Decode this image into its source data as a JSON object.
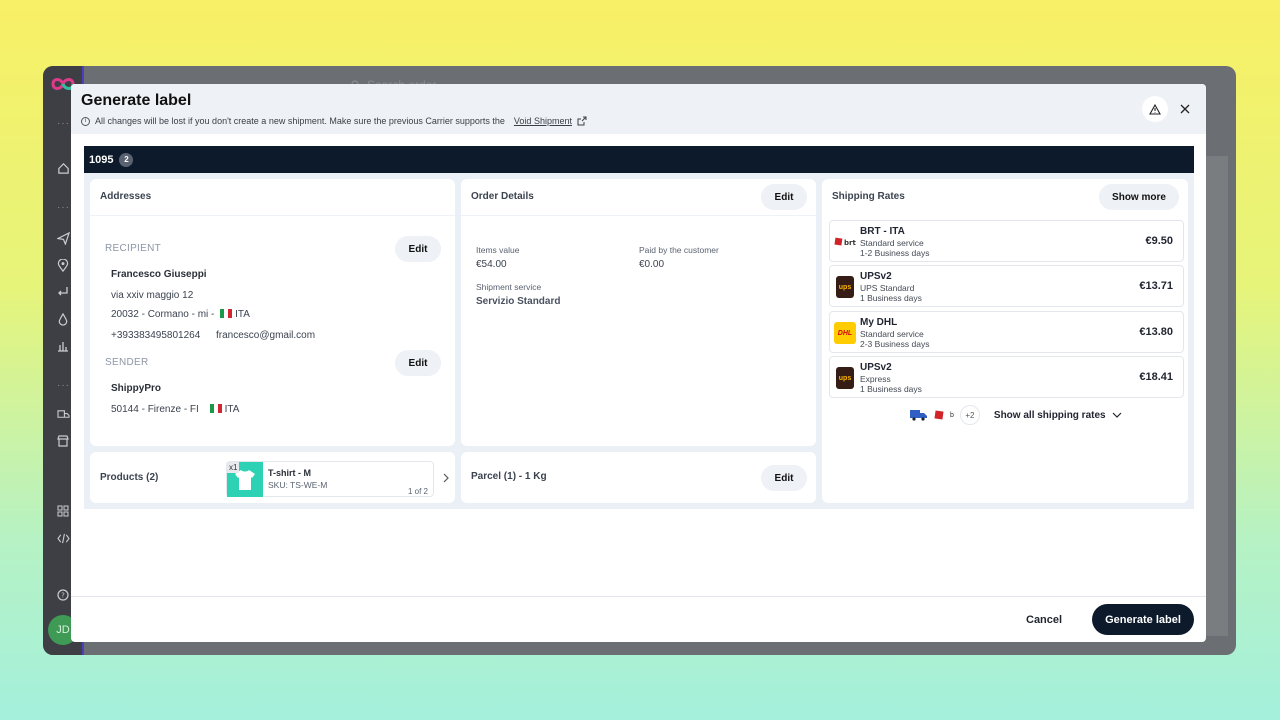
{
  "background_app": {
    "search_placeholder": "Search order",
    "user_initials": "JD",
    "accent_color": "#4a3fbf"
  },
  "modal": {
    "title": "Generate label",
    "warning_text": "All changes will be lost if you don't create a new shipment. Make sure the previous Carrier supports the",
    "warning_link": "Void Shipment",
    "order_number": "1095",
    "order_count": "2"
  },
  "addresses": {
    "title": "Addresses",
    "recipient_label": "RECIPIENT",
    "recipient_edit": "Edit",
    "recipient_name": "Francesco Giuseppi",
    "recipient_street": "via xxiv maggio 12",
    "recipient_city": "20032 - Cormano - mi -",
    "recipient_country": "ITA",
    "recipient_phone": "+393383495801264",
    "recipient_email": "francesco@gmail.com",
    "sender_label": "SENDER",
    "sender_edit": "Edit",
    "sender_name": "ShippyPro",
    "sender_city": "50144 - Firenze - FI",
    "sender_country": "ITA"
  },
  "order_details": {
    "title": "Order Details",
    "edit": "Edit",
    "items_value_label": "Items value",
    "items_value": "€54.00",
    "paid_label": "Paid by the customer",
    "paid_value": "€0.00",
    "service_label": "Shipment service",
    "service_value": "Servizio Standard"
  },
  "shipping_rates": {
    "title": "Shipping Rates",
    "show_more": "Show more",
    "rates": [
      {
        "carrier": "BRT - ITA",
        "service": "Standard service",
        "days": "1-2 Business days",
        "price": "€9.50",
        "logo": "brt"
      },
      {
        "carrier": "UPSv2",
        "service": "UPS Standard",
        "days": "1 Business days",
        "price": "€13.71",
        "logo": "ups"
      },
      {
        "carrier": "My DHL",
        "service": "Standard service",
        "days": "2-3 Business days",
        "price": "€13.80",
        "logo": "DHL"
      },
      {
        "carrier": "UPSv2",
        "service": "Express",
        "days": "1 Business days",
        "price": "€18.41",
        "logo": "ups"
      }
    ],
    "extra_carriers": "+2",
    "show_all": "Show all shipping rates"
  },
  "products": {
    "title": "Products (2)",
    "quantity": "x1",
    "name": "T-shirt - M",
    "sku": "SKU: TS-WE-M",
    "pager": "1 of 2"
  },
  "parcel": {
    "title": "Parcel (1) - 1 Kg",
    "edit": "Edit"
  },
  "footer": {
    "cancel": "Cancel",
    "generate": "Generate label"
  },
  "colors": {
    "dark": "#0c1a2b",
    "ups": "#351c15",
    "ups_gold": "#ffb500",
    "dhl": "#ffcc00",
    "brt": "#d2232a",
    "thumb": "#2dd2b4"
  }
}
